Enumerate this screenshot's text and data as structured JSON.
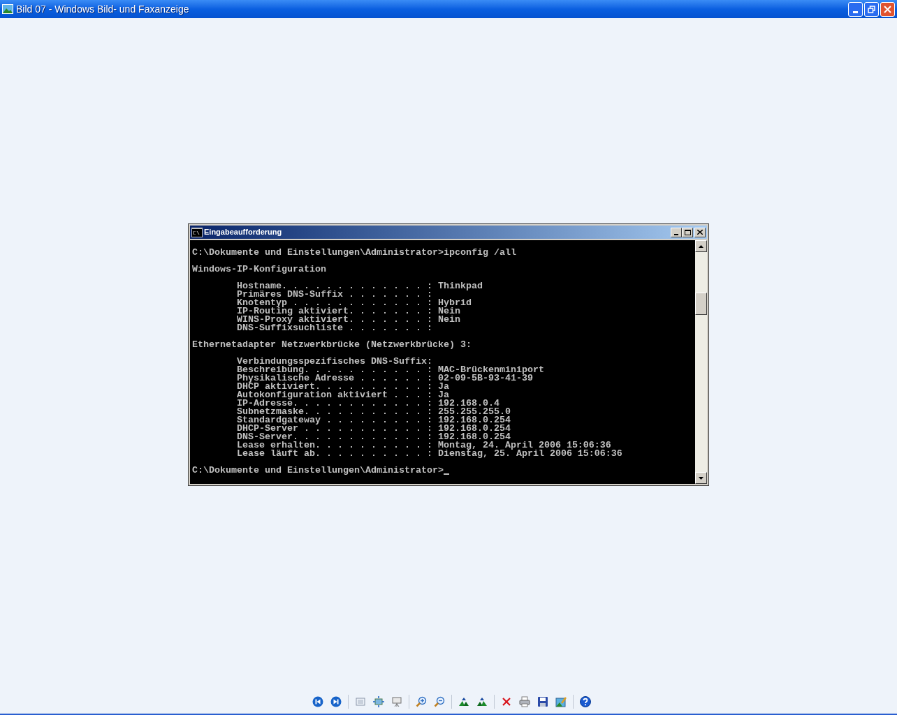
{
  "window": {
    "title": "Bild 07 - Windows Bild- und Faxanzeige"
  },
  "console": {
    "title": "Eingabeaufforderung",
    "blocks": [
      [
        "C:\\Dokumente und Einstellungen\\Administrator>ipconfig /all"
      ],
      [
        "Windows-IP-Konfiguration"
      ],
      [
        "        Hostname. . . . . . . . . . . . . : Thinkpad",
        "        Primäres DNS-Suffix . . . . . . . :",
        "        Knotentyp . . . . . . . . . . . . : Hybrid",
        "        IP-Routing aktiviert. . . . . . . : Nein",
        "        WINS-Proxy aktiviert. . . . . . . : Nein",
        "        DNS-Suffixsuchliste . . . . . . . :"
      ],
      [
        "Ethernetadapter Netzwerkbrücke (Netzwerkbrücke) 3:"
      ],
      [
        "        Verbindungsspezifisches DNS-Suffix:",
        "        Beschreibung. . . . . . . . . . . : MAC-Brückenminiport",
        "        Physikalische Adresse . . . . . . : 02-09-5B-93-41-39",
        "        DHCP aktiviert. . . . . . . . . . : Ja",
        "        Autokonfiguration aktiviert . . . : Ja",
        "        IP-Adresse. . . . . . . . . . . . : 192.168.0.4",
        "        Subnetzmaske. . . . . . . . . . . : 255.255.255.0",
        "        Standardgateway . . . . . . . . . : 192.168.0.254",
        "        DHCP-Server . . . . . . . . . . . : 192.168.0.254",
        "        DNS-Server. . . . . . . . . . . . : 192.168.0.254",
        "        Lease erhalten. . . . . . . . . . : Montag, 24. April 2006 15:06:36",
        "        Lease läuft ab. . . . . . . . . . : Dienstag, 25. April 2006 15:06:36"
      ],
      [
        "C:\\Dokumente und Einstellungen\\Administrator>"
      ]
    ]
  },
  "toolbar": {
    "groups": [
      [
        {
          "kind": "previous"
        },
        {
          "kind": "next"
        }
      ],
      [
        {
          "kind": "fit"
        },
        {
          "kind": "actual"
        },
        {
          "kind": "slideshow"
        }
      ],
      [
        {
          "kind": "zoomin"
        },
        {
          "kind": "zoomout"
        }
      ],
      [
        {
          "kind": "rotcw"
        },
        {
          "kind": "rotccw"
        }
      ],
      [
        {
          "kind": "delete"
        },
        {
          "kind": "print"
        },
        {
          "kind": "save"
        },
        {
          "kind": "edit"
        }
      ],
      [
        {
          "kind": "help"
        }
      ]
    ]
  }
}
